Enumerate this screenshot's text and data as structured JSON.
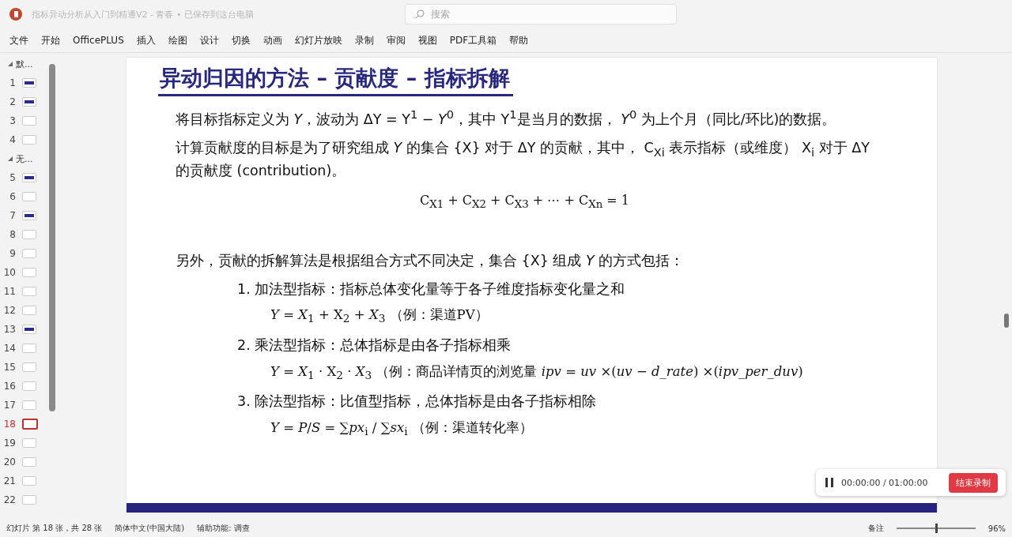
{
  "window": {
    "title": "指标异动分析从入门到精通V2 - 青春 • 已保存到这台电脑",
    "search_placeholder": "搜索"
  },
  "ribbon_tabs": [
    "文件",
    "开始",
    "OfficePLUS",
    "插入",
    "绘图",
    "设计",
    "切换",
    "动画",
    "幻灯片放映",
    "录制",
    "审阅",
    "视图",
    "PDF工具箱",
    "帮助"
  ],
  "slides_panel": [
    {
      "label": "默...",
      "expanded": true,
      "slides": [
        {
          "number": "1",
          "kind": "dark",
          "selected": false
        },
        {
          "number": "2",
          "kind": "dark",
          "selected": false
        },
        {
          "number": "3",
          "kind": "light",
          "selected": false
        },
        {
          "number": "4",
          "kind": "light",
          "selected": false
        }
      ]
    },
    {
      "label": "无...",
      "expanded": true,
      "slides": [
        {
          "number": "5",
          "kind": "dark",
          "selected": false
        },
        {
          "number": "6",
          "kind": "light",
          "selected": false
        },
        {
          "number": "7",
          "kind": "dark",
          "selected": false
        },
        {
          "number": "8",
          "kind": "light",
          "selected": false
        },
        {
          "number": "9",
          "kind": "light",
          "selected": false
        },
        {
          "number": "10",
          "kind": "light",
          "selected": false
        },
        {
          "number": "11",
          "kind": "light",
          "selected": false
        },
        {
          "number": "12",
          "kind": "light",
          "selected": false
        },
        {
          "number": "13",
          "kind": "dark",
          "selected": false
        },
        {
          "number": "14",
          "kind": "light",
          "selected": false
        },
        {
          "number": "15",
          "kind": "light",
          "selected": false
        },
        {
          "number": "16",
          "kind": "light",
          "selected": false
        },
        {
          "number": "17",
          "kind": "light",
          "selected": false
        },
        {
          "number": "18",
          "kind": "light",
          "selected": true
        },
        {
          "number": "19",
          "kind": "light",
          "selected": false
        },
        {
          "number": "20",
          "kind": "light",
          "selected": false
        },
        {
          "number": "21",
          "kind": "light",
          "selected": false
        },
        {
          "number": "22",
          "kind": "light",
          "selected": false
        }
      ]
    }
  ],
  "slide": {
    "title": "异动归因的方法 – 贡献度 – 指标拆解",
    "paragraphs": [
      "将目标指标定义为 *Y*，波动为 ΔY = Y$^{1}$ − *Y*$^{0}$，其中 Y$^{1}$是当月的数据， *Y*$^{0}$ 为上个月（同比/环比)的数据。",
      "计算贡献度的目标是为了研究组成 *Y* 的集合 {X} 对于  ΔY 的贡献，其中， C$_{Xi}$ 表示指标（或维度） X$_{i}$ 对于 ΔY 的贡献度 (contribution)。"
    ],
    "formula": "C$_{X1}$ + C$_{X2}$ + C$_{X3}$ + ⋯ + C$_{Xn}$ = 1",
    "intro": "另外，贡献的拆解算法是根据组合方式不同决定，集合 {X} 组成 *Y* 的方式包括：",
    "items": [
      {
        "number": "1.",
        "text": "加法型指标：指标总体变化量等于各子维度指标变化量之和",
        "formula": "*Y* = *X*$_{1}$ + X$_{2}$ + *X*$_{3}$  （例：渠道PV）"
      },
      {
        "number": "2.",
        "text": "乘法型指标：总体指标是由各子指标相乘",
        "formula": "*Y* = *X*$_{1}$ · X$_{2}$ · *X*$_{3}$ （例：商品详情页的浏览量 *ipv* = *uv* ×(*uv* − *d_rate*) ×(*ipv_per_duv*)"
      },
      {
        "number": "3.",
        "text": "除法型指标：比值型指标，总体指标是由各子指标相除",
        "formula": "*Y* = *P*/*S* = ∑*px*$_{i}$ / ∑*sx*$_{i}$ （例：渠道转化率）"
      }
    ]
  },
  "recorder": {
    "time": "00:00:00 / 01:00:00",
    "stop_button": "结束录制"
  },
  "status_bar": {
    "slide_info": "幻灯片 第 18 张，共 28 张",
    "language": "简体中文(中国大陆)",
    "accessibility": "辅助功能: 调查",
    "notes": "备注",
    "zoom": "96%",
    "zoom_level": {
      "level": 0.5
    }
  }
}
